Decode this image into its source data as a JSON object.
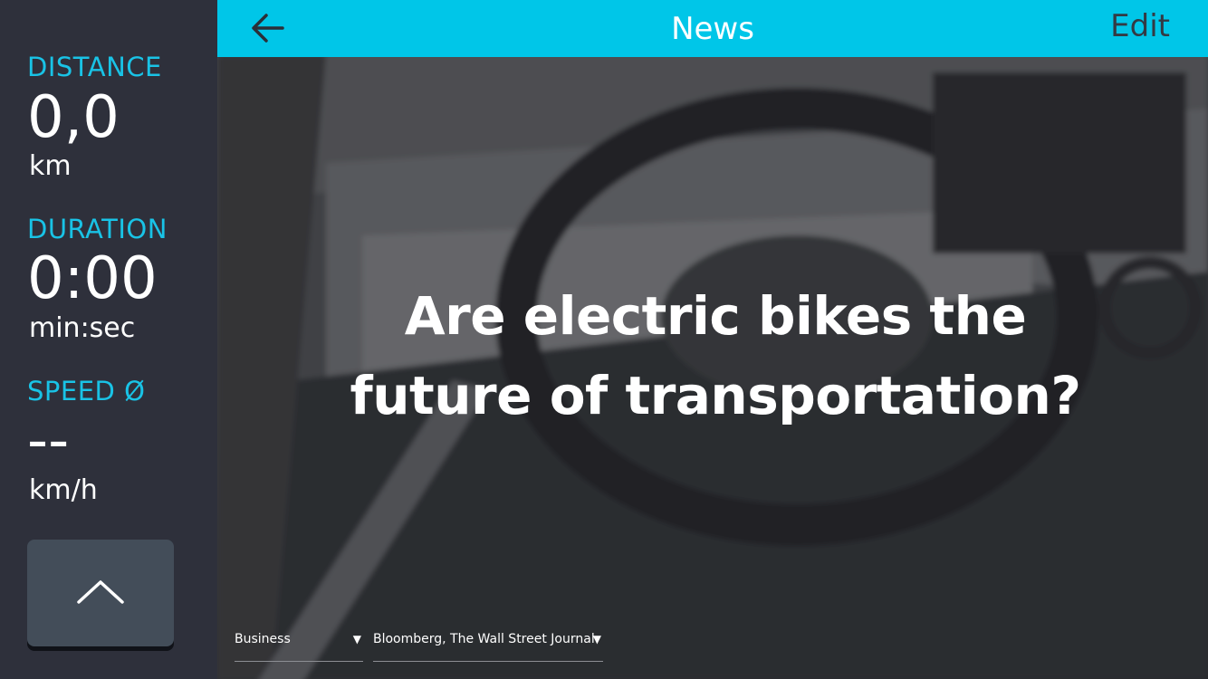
{
  "sidebar": {
    "distance": {
      "label": "DISTANCE",
      "value": "0,0",
      "unit": "km"
    },
    "duration": {
      "label": "DURATION",
      "value": "0:00",
      "unit": "min:sec"
    },
    "speed": {
      "label": "SPEED Ø",
      "value": "--",
      "unit": "km/h"
    },
    "collapse_icon": "chevron-up-icon"
  },
  "header": {
    "back_icon": "arrow-left-icon",
    "title": "News",
    "edit_label": "Edit"
  },
  "article": {
    "headline": "Are electric bikes the future of transportation?"
  },
  "filters": {
    "category": "Business",
    "sources": "Bloomberg, The Wall Street Journal",
    "arrow": "▼"
  },
  "colors": {
    "accent": "#00c6e8",
    "sidebar_bg": "#2e303b",
    "label": "#19c3e6",
    "button_bg": "#434d59"
  }
}
